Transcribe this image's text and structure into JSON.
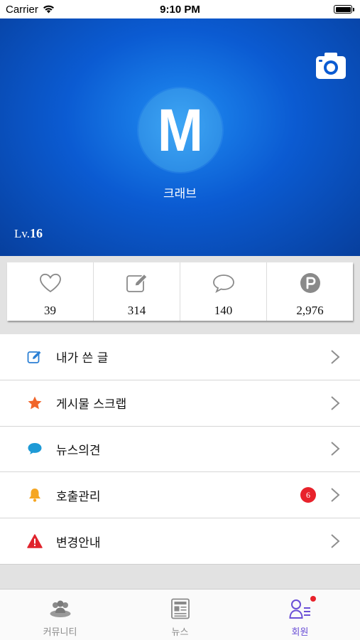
{
  "status_bar": {
    "carrier": "Carrier",
    "time": "9:10 PM"
  },
  "profile": {
    "avatar_letter": "M",
    "nickname": "크래브",
    "level_prefix": "Lv.",
    "level_value": "16"
  },
  "stats": [
    {
      "icon": "heart-icon",
      "value": "39"
    },
    {
      "icon": "edit-icon",
      "value": "314"
    },
    {
      "icon": "comment-icon",
      "value": "140"
    },
    {
      "icon": "point-icon",
      "value": "2,976"
    }
  ],
  "menu": [
    {
      "icon": "pencil-square-icon",
      "label": "내가 쓴 글"
    },
    {
      "icon": "star-icon",
      "label": "게시물 스크랩"
    },
    {
      "icon": "speech-bubble-icon",
      "label": "뉴스의견"
    },
    {
      "icon": "bell-icon",
      "label": "호출관리",
      "badge": "6"
    },
    {
      "icon": "warning-icon",
      "label": "변경안내"
    }
  ],
  "tabs": [
    {
      "icon": "community-icon",
      "label": "커뮤니티"
    },
    {
      "icon": "news-icon",
      "label": "뉴스"
    },
    {
      "icon": "member-icon",
      "label": "회원",
      "active": true
    }
  ],
  "colors": {
    "hero_blue": "#0b5bd2",
    "accent_purple": "#6a4fd6",
    "badge_red": "#e8222b",
    "star_orange": "#f0652a",
    "bell_orange": "#f5a623",
    "bubble_blue": "#1e9ad6"
  }
}
